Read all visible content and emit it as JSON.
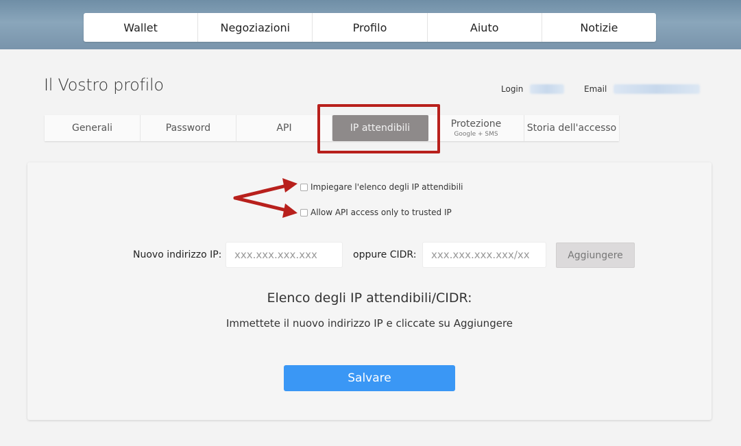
{
  "topnav": {
    "items": [
      {
        "label": "Wallet"
      },
      {
        "label": "Negoziazioni"
      },
      {
        "label": "Profilo"
      },
      {
        "label": "Aiuto"
      },
      {
        "label": "Notizie"
      }
    ]
  },
  "page": {
    "title": "Il Vostro profilo",
    "login_label": "Login",
    "email_label": "Email"
  },
  "tabs": {
    "items": [
      {
        "label": "Generali",
        "sub": ""
      },
      {
        "label": "Password",
        "sub": ""
      },
      {
        "label": "API",
        "sub": ""
      },
      {
        "label": "IP attendibili",
        "sub": ""
      },
      {
        "label": "Protezione",
        "sub": "Google + SMS"
      },
      {
        "label": "Storia dell'accesso",
        "sub": ""
      }
    ],
    "active_index": 3
  },
  "form": {
    "use_trusted_ip_label": "Impiegare l'elenco degli IP attendibili",
    "api_only_trusted_label": "Allow API access only to trusted IP",
    "new_ip_label": "Nuovo indirizzo IP:",
    "new_ip_placeholder": "xxx.xxx.xxx.xxx",
    "cidr_label": "oppure CIDR:",
    "cidr_placeholder": "xxx.xxx.xxx.xxx/xx",
    "add_button": "Aggiungere",
    "list_title": "Elenco degli IP attendibili/CIDR:",
    "list_hint": "Immettete il nuovo indirizzo IP e cliccate su Aggiungere",
    "save_button": "Salvare"
  },
  "colors": {
    "annotation_red": "#b8201c",
    "save_blue": "#3a97f5",
    "active_tab_gray": "#8e8a8a"
  }
}
